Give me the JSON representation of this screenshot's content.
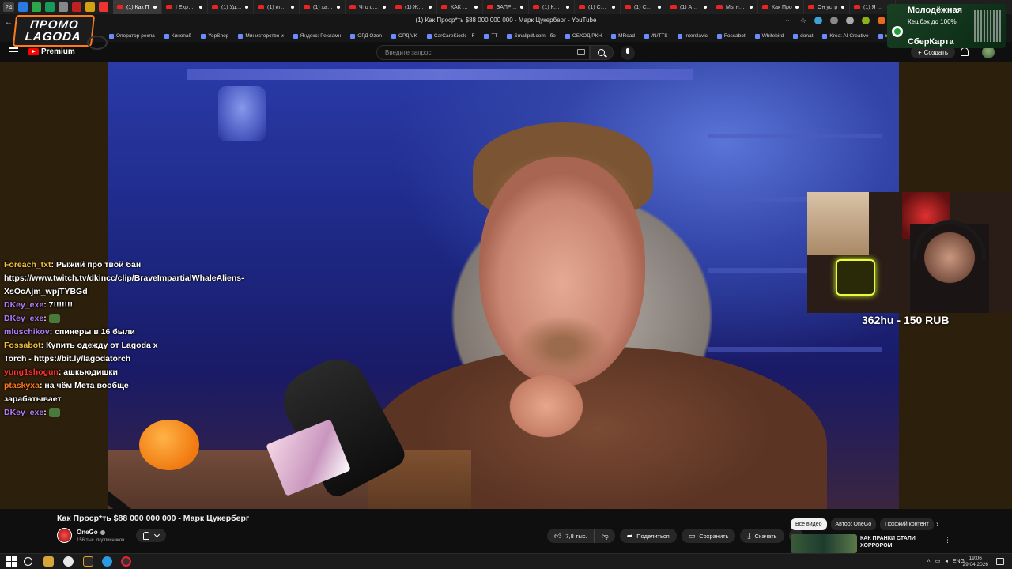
{
  "browser": {
    "window_badge": "24",
    "page_title": "(1) Как Проср*ть $88 000 000 000 - Марк Цукерберг - YouTube",
    "tabs": [
      {
        "label": "(1) Как П",
        "active": true
      },
      {
        "label": "I Exposed",
        "active": false
      },
      {
        "label": "(1) Удиви",
        "active": false
      },
      {
        "label": "(1) кто и за",
        "active": false
      },
      {
        "label": "(1) харчев",
        "active": false
      },
      {
        "label": "Что стал",
        "active": false
      },
      {
        "label": "(1) ЖЕНСК",
        "active": false
      },
      {
        "label": "КАК ПРАНК",
        "active": false
      },
      {
        "label": "ЗАПРЕЩЕ",
        "active": false
      },
      {
        "label": "(1) КАРТА",
        "active": false
      },
      {
        "label": "(1) СКУФ",
        "active": false
      },
      {
        "label": "(1) СИЛЬН",
        "active": false
      },
      {
        "label": "(1) АЛАБУ",
        "active": false
      },
      {
        "label": "Мы не д",
        "active": false
      },
      {
        "label": "Как Про",
        "active": false
      },
      {
        "label": "Он устр",
        "active": false
      },
      {
        "label": "(1) Я стал",
        "active": false
      }
    ],
    "bookmarks": [
      "Оператор рекла",
      "Кинопаб",
      "YepShop",
      "Министерство и",
      "Яндекс: Рекламн",
      "ОРД Ozon",
      "ОРД VK",
      "CarCareKiosk – F",
      "TT",
      "Smallpdf.com - бе",
      "ОБХОД РКН",
      "MRoad",
      "/N/TTS",
      "Interslavic",
      "Fossabot",
      "Whitebird",
      "donat",
      "Krea: AI Creative",
      "кобальт"
    ]
  },
  "promo_overlay": {
    "line1": "ПРОМО",
    "line2": "LAGODA"
  },
  "youtube": {
    "brand": "Premium",
    "search_placeholder": "Введите запрос",
    "create_label": "Создать",
    "video_title": "Как Проср*ть $88 000 000 000 - Марк Цукерберг",
    "channel_name": "OneGo",
    "subscribers": "156 тыс. подписчиков",
    "likes": "7,8 тыс.",
    "share_label": "Поделиться",
    "save_label": "Сохранить",
    "download_label": "Скачать",
    "chips": [
      "Все видео",
      "Автор: OneGo",
      "Похожий контент"
    ],
    "recommendation_title": "КАК ПРАНКИ СТАЛИ ХОРРОРОМ"
  },
  "ad": {
    "line1": "Молодёжная",
    "line2": "Кешбэк до 100%",
    "line3": "СберКарта"
  },
  "chat": [
    {
      "user": "Foreach_txt",
      "color": "#f0c040",
      "message": "Рыжий про твой бан https://www.twitch.tv/dkincc/clip/BraveImpartialWhaleAliens-XsOcAjm_wpjTYBGd"
    },
    {
      "user": "DKey_exe",
      "color": "#b07cff",
      "message": "7!!!!!!!"
    },
    {
      "user": "DKey_exe",
      "color": "#b07cff",
      "message": ""
    },
    {
      "user": "mluschikov",
      "color": "#b07cff",
      "message": "спинеры в 16 были"
    },
    {
      "user": "Fossabot",
      "color": "#f0c040",
      "message": "Купить одежду от Lagoda x Torch - https://bit.ly/lagodatorch"
    },
    {
      "user": "yung1shogun",
      "color": "#ff3030",
      "message": "ашкьюдишки"
    },
    {
      "user": "ptaskyxa",
      "color": "#ff7a1a",
      "message": "на чём Мета вообще зарабатывает"
    },
    {
      "user": "DKey_exe",
      "color": "#b07cff",
      "message": ""
    }
  ],
  "donation": "362hu - 150 RUB",
  "taskbar": {
    "lang": "ENG",
    "time": "19:06",
    "date": "29.04.2026"
  }
}
